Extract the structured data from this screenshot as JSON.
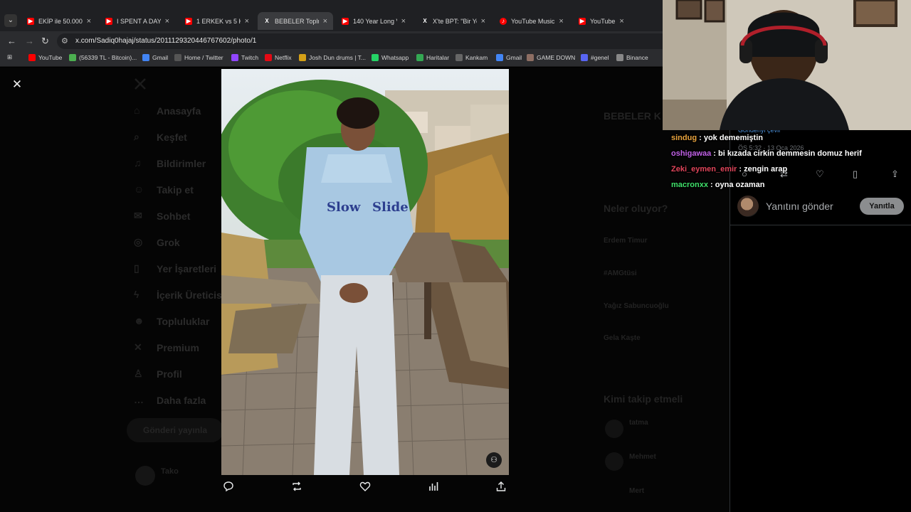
{
  "tabs": [
    {
      "label": "EKİP ile 50.000TL",
      "icon": "youtube-icon",
      "active": false
    },
    {
      "label": "I SPENT A DAY W",
      "icon": "youtube-icon",
      "active": false
    },
    {
      "label": "1 ERKEK vs 5 KAD",
      "icon": "youtube-icon",
      "active": false
    },
    {
      "label": "BEBELER Topluluk",
      "icon": "x-icon",
      "active": true
    },
    {
      "label": "140 Year Long Vid",
      "icon": "youtube-icon",
      "active": false
    },
    {
      "label": "X'te BPT: \"Bir You",
      "icon": "x-icon",
      "active": false
    },
    {
      "label": "YouTube Music",
      "icon": "youtube-music-icon",
      "active": false
    },
    {
      "label": "YouTube",
      "icon": "youtube-icon",
      "active": false
    }
  ],
  "address_bar": {
    "url": "x.com/Sadiq0hajaj/status/2011129320446767602/photo/1"
  },
  "bookmarks": [
    {
      "label": "YouTube",
      "color": "#ff0000"
    },
    {
      "label": "(56339 TL - Bitcoin)...",
      "color": "#4caf50"
    },
    {
      "label": "Gmail",
      "color": "#4285f4"
    },
    {
      "label": "Home / Twitter",
      "color": "#555555"
    },
    {
      "label": "Twitch",
      "color": "#9146ff"
    },
    {
      "label": "Netflix",
      "color": "#e50914"
    },
    {
      "label": "Josh Dun drums | T...",
      "color": "#d4a017"
    },
    {
      "label": "Whatsapp",
      "color": "#25d366"
    },
    {
      "label": "Haritalar",
      "color": "#34a853"
    },
    {
      "label": "Kankam",
      "color": "#666666"
    },
    {
      "label": "Gmail",
      "color": "#4285f4"
    },
    {
      "label": "GAME DOWN",
      "color": "#8d6e63"
    },
    {
      "label": "#genel",
      "color": "#5865f2"
    },
    {
      "label": "Binance",
      "color": "#888888"
    }
  ],
  "sidebar": {
    "items": [
      {
        "label": "Anasayfa",
        "icon": "home-icon"
      },
      {
        "label": "Keşfet",
        "icon": "search-icon"
      },
      {
        "label": "Bildirimler",
        "icon": "bell-icon"
      },
      {
        "label": "Takip et",
        "icon": "follow-icon"
      },
      {
        "label": "Sohbet",
        "icon": "mail-icon"
      },
      {
        "label": "Grok",
        "icon": "grok-icon"
      },
      {
        "label": "Yer İşaretleri",
        "icon": "bookmark-icon"
      },
      {
        "label": "İçerik Üreticis",
        "icon": "lightning-icon"
      },
      {
        "label": "Topluluklar",
        "icon": "people-icon"
      },
      {
        "label": "Premium",
        "icon": "x-icon"
      },
      {
        "label": "Profil",
        "icon": "person-icon"
      },
      {
        "label": "Daha fazla",
        "icon": "more-icon"
      }
    ],
    "post_button": "Gönderi yayınla",
    "account_name": "Tako"
  },
  "right_column": {
    "community_title": "BEBELER K",
    "trending_title": "Neler oluyor?",
    "trends": [
      "Erdem Timur",
      "#AMGtüsi",
      "Yağız Sabuncuoğlu",
      "Gela Kaşte"
    ],
    "who_to_follow_title": "Kimi takip etmeli",
    "follow_suggestions": [
      "tatma",
      "Mehmet",
      "Mert"
    ]
  },
  "reply_panel": {
    "posted_link": "Gönderiyi çevir",
    "posted_time": "ÖS 5:32 · 13 Oca 2026",
    "placeholder": "Yanıtını gönder",
    "reply_button": "Yanıtla"
  },
  "chat": [
    {
      "user": "sindug",
      "message": " : yok dememiştin",
      "color": "#e8a33d"
    },
    {
      "user": "oshigawaa",
      "message": " : bi kızada cirkin demmesin domuz herif",
      "color": "#c061e6"
    },
    {
      "user": "Zeki_eymen_emir",
      "message": " : zengin arap",
      "color": "#e0455a"
    },
    {
      "user": "macronxx",
      "message": " : oyna ozaman",
      "color": "#3fe06a"
    }
  ],
  "colors": {
    "background": "#000000",
    "chrome": "#1f2023",
    "accent": "#1d9bf0"
  }
}
